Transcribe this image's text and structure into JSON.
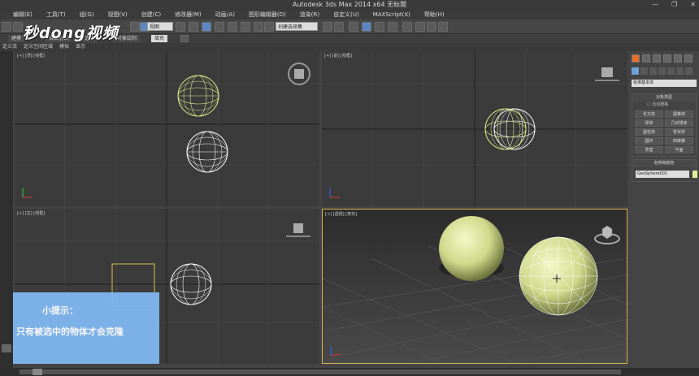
{
  "window": {
    "title": "Autodesk 3ds Max  2014 x64    无标题",
    "min": "—",
    "restore": "❐",
    "close": "✕"
  },
  "menu": [
    "编辑(E)",
    "工具(T)",
    "组(G)",
    "视图(V)",
    "创建(C)",
    "修改器(M)",
    "动画(A)",
    "图形编辑器(D)",
    "渲染(R)",
    "自定义(U)",
    "MAXScript(X)",
    "帮助(H)"
  ],
  "toolbar": {
    "view_dropdown": "视图",
    "selset_dropdown": "创建选择集"
  },
  "ribbon": {
    "items": [
      "建模",
      "自由形式",
      "选择",
      "对象绘制",
      "填充"
    ]
  },
  "subbar": [
    "定义流",
    "定义空间区域",
    "模拟",
    "显示"
  ],
  "viewports": {
    "top": {
      "label": "[+] [顶] [线框]"
    },
    "front": {
      "label": "[+] [前] [线框]"
    },
    "left": {
      "label": "[+] [左] [线框]"
    },
    "persp": {
      "label": "[+] [透视] [真实]"
    }
  },
  "command_panel": {
    "dropdown": "标准基本体",
    "object_type_title": "对象类型",
    "autogrid": "自动栅格",
    "buttons": [
      "长方体",
      "圆锥体",
      "球体",
      "几何球体",
      "圆柱体",
      "管状体",
      "圆环",
      "四棱锥",
      "茶壶",
      "平面"
    ],
    "name_color_title": "名称和颜色",
    "name_value": "GeoSphere001"
  },
  "overlay": {
    "logo": "秒dong视频",
    "tip_title": "小提示：",
    "tip_body": "只有被选中的物体才会克隆"
  },
  "colors": {
    "selected": "#e0ee8a",
    "wire": "#ffffff",
    "active_border": "#d8b24a"
  }
}
